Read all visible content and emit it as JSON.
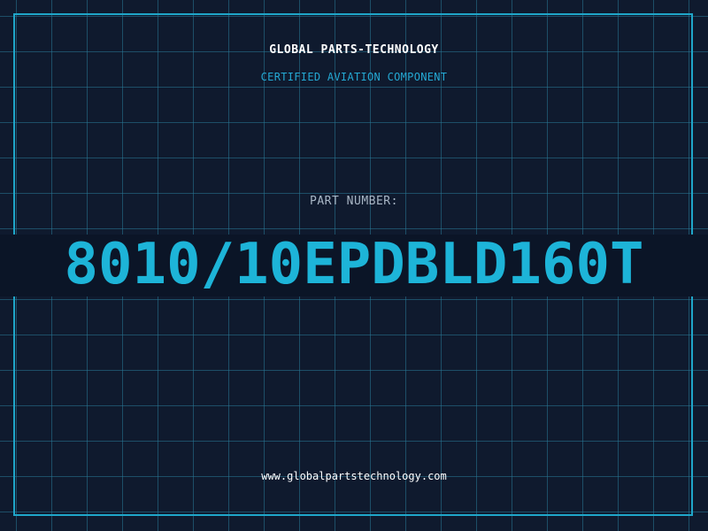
{
  "header": {
    "brand": "GLOBAL PARTS-TECHNOLOGY",
    "subtitle": "CERTIFIED AVIATION COMPONENT"
  },
  "part": {
    "label": "PART NUMBER:",
    "number": "8010/10EPDBLD160T"
  },
  "footer": {
    "url": "www.globalpartstechnology.com"
  },
  "colors": {
    "background": "#0f1a2e",
    "grid": "#28789a",
    "accent": "#1db4d8",
    "frame": "#1fa6c9",
    "label": "#a9b7c6",
    "text": "#ffffff"
  }
}
